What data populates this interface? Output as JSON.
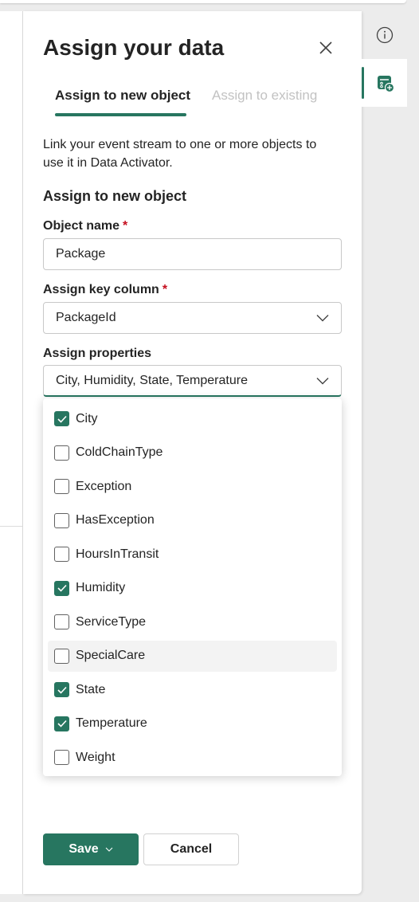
{
  "panel": {
    "title": "Assign your data",
    "tabs": [
      {
        "label": "Assign to new object",
        "active": true
      },
      {
        "label": "Assign to existing",
        "active": false
      }
    ],
    "description": "Link your event stream to one or more objects to use it in Data Activator.",
    "section_title": "Assign to new object",
    "object_name": {
      "label": "Object name",
      "required": "*",
      "value": "Package"
    },
    "key_column": {
      "label": "Assign key column",
      "required": "*",
      "value": "PackageId"
    },
    "properties": {
      "label": "Assign properties",
      "value": "City, Humidity, State, Temperature",
      "options": [
        {
          "label": "City",
          "checked": true
        },
        {
          "label": "ColdChainType",
          "checked": false
        },
        {
          "label": "Exception",
          "checked": false
        },
        {
          "label": "HasException",
          "checked": false
        },
        {
          "label": "HoursInTransit",
          "checked": false
        },
        {
          "label": "Humidity",
          "checked": true
        },
        {
          "label": "ServiceType",
          "checked": false
        },
        {
          "label": "SpecialCare",
          "checked": false
        },
        {
          "label": "State",
          "checked": true
        },
        {
          "label": "Temperature",
          "checked": true
        },
        {
          "label": "Weight",
          "checked": false
        }
      ]
    },
    "save_label": "Save",
    "cancel_label": "Cancel"
  },
  "rail": {
    "icons": [
      "info-icon",
      "assign-data-icon"
    ]
  },
  "colors": {
    "accent": "#277660",
    "required": "#c50f1f"
  }
}
